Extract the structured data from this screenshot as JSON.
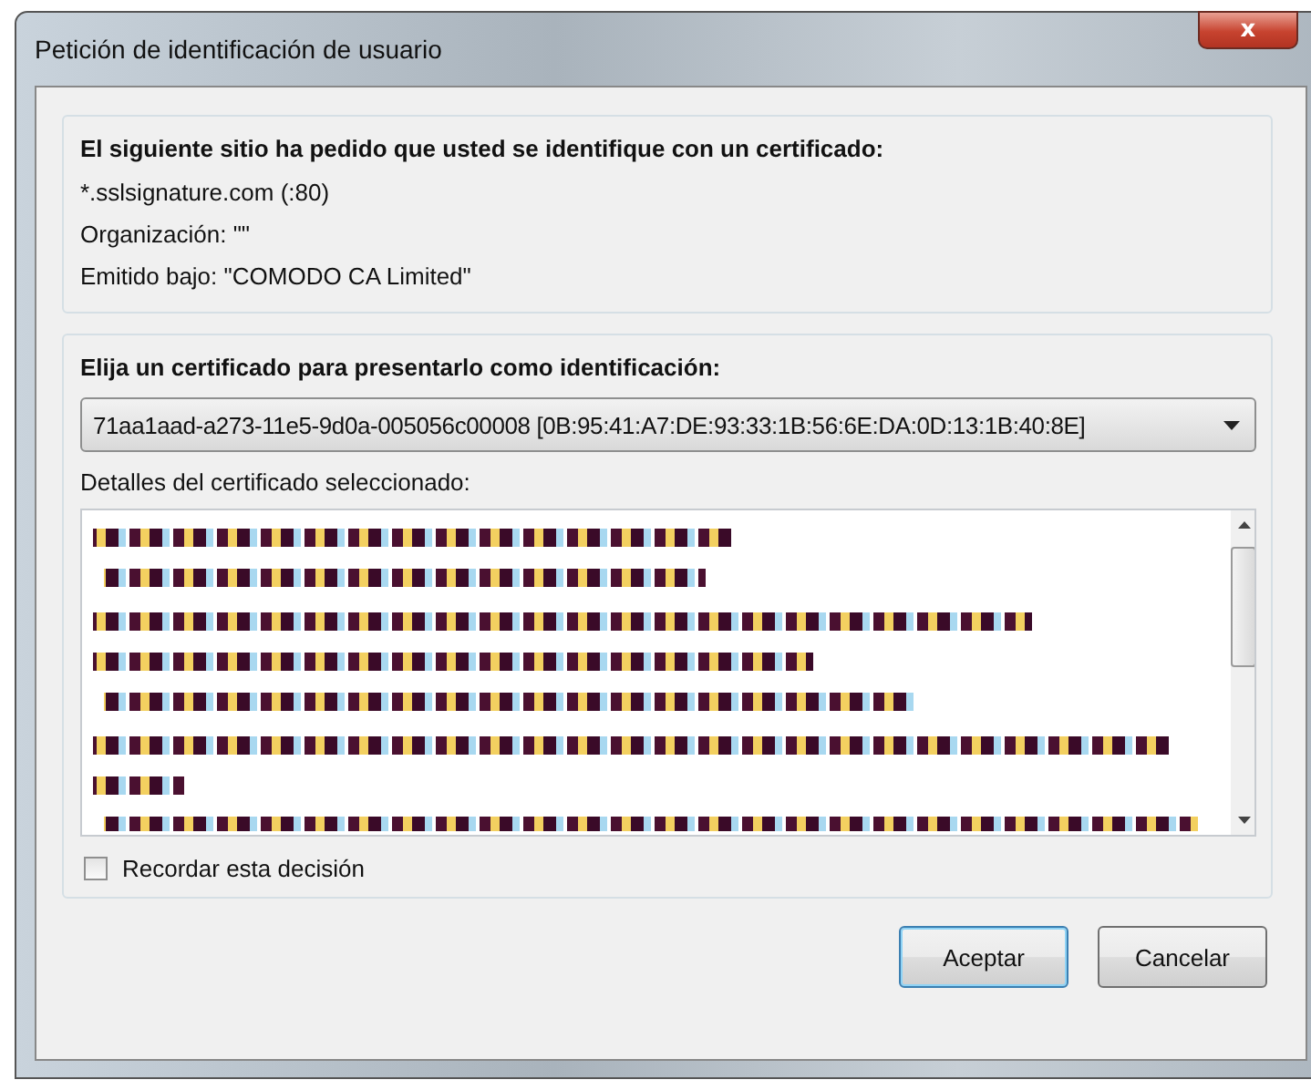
{
  "window": {
    "title": "Petición de identificación de usuario",
    "close": "x"
  },
  "site_group": {
    "heading": "El siguiente sitio ha pedido que usted se identifique con un certificado:",
    "lines": [
      "*.sslsignature.com (:80)",
      "Organización: \"\"",
      "Emitido bajo: \"COMODO CA Limited\""
    ]
  },
  "certificate_group": {
    "heading": "Elija un certificado para presentarlo como identificación:",
    "select": {
      "value": "71aa1aad-a273-11e5-9d0a-005056c00008 [0B:95:41:A7:DE:93:33:1B:56:6E:DA:0D:13:1B:40:8E]"
    },
    "details_label": "Detalles del certificado seleccionado:",
    "remember": {
      "label": "Recordar esta decisión",
      "checked": false
    }
  },
  "buttons": [
    {
      "label": "Aceptar",
      "default": true
    },
    {
      "label": "Cancelar",
      "default": false
    }
  ]
}
